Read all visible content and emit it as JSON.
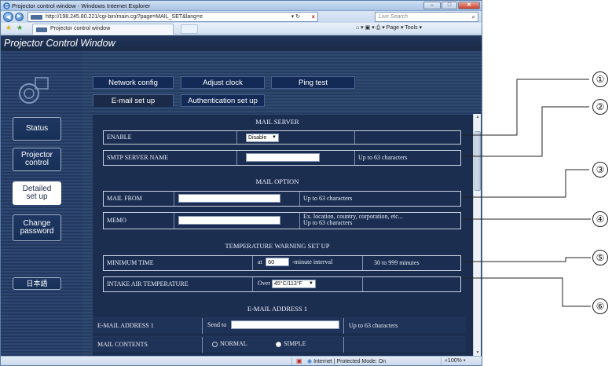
{
  "window": {
    "title": "Projector control window - Windows Internet Explorer",
    "min": "–",
    "max": "□",
    "close": "✕"
  },
  "address": {
    "url": "http://198.245.80.221/cgi-bin/main.cgi?page=MAIL_SET&lang=e",
    "search_placeholder": "Live Search",
    "back_icon": "◀",
    "forward_icon": "▶",
    "stop_icon": "×",
    "search_icon": "⌕"
  },
  "favorites": {
    "tab_title": "Projector control window",
    "tools": "⌂ ▾  ▣ ▾  ⎙ ▾  Page ▾  Tools ▾"
  },
  "page": {
    "title": "Projector Control Window",
    "sidebar": [
      {
        "label": "Status"
      },
      {
        "label": "Projector\ncontrol"
      },
      {
        "label": "Detailed\nset up"
      },
      {
        "label": "Change\npassword"
      },
      {
        "label": "日本語"
      }
    ],
    "tabs_top": [
      "Network config",
      "Adjust clock",
      "Ping test"
    ],
    "tabs_bottom": [
      "E-mail set up",
      "Authentication set up"
    ],
    "active_tab": "E-mail set up"
  },
  "mail_server": {
    "heading": "MAIL SERVER",
    "enable_label": "ENABLE",
    "enable_value": "Disable",
    "smtp_label": "SMTP SERVER NAME",
    "smtp_value": "",
    "smtp_hint": "Up to 63 characters"
  },
  "mail_option": {
    "heading": "MAIL OPTION",
    "from_label": "MAIL FROM",
    "from_value": "",
    "from_hint": "Up to 63 characters",
    "memo_label": "MEMO",
    "memo_value": "",
    "memo_hint_1": "Ex. location, country, corporation, etc...",
    "memo_hint_2": "Up to 63 characters"
  },
  "temperature": {
    "heading": "TEMPERATURE WARNING SET UP",
    "min_time_label": "MINIMUM TIME",
    "min_time_prefix": "at",
    "min_time_value": "60",
    "min_time_suffix": "-minute interval",
    "min_time_hint": "30 to 999 minutes",
    "intake_label": "INTAKE AIR TEMPERATURE",
    "intake_prefix": "Over",
    "intake_value": "45°C/113°F"
  },
  "email1": {
    "heading": "E-MAIL ADDRESS 1",
    "address_label": "E-MAIL ADDRESS 1",
    "send_to": "Send to",
    "address_value": "",
    "address_hint": "Up to 63 characters",
    "contents_label": "MAIL CONTENTS",
    "normal": "NORMAL",
    "simple": "SIMPLE",
    "selected": "SIMPLE"
  },
  "status_bar": {
    "zone": "Internet | Protected Mode: On",
    "zoom": "100%"
  },
  "callouts": [
    "①",
    "②",
    "③",
    "④",
    "⑤",
    "⑥"
  ],
  "colors": {
    "page_bg": "#1b2c4c",
    "panel_bg": "#1c2e50",
    "row_border": "#c7d0df",
    "callout_line": "#222222"
  }
}
